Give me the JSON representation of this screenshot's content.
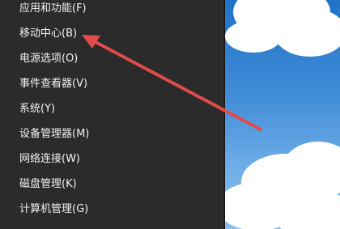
{
  "menu": {
    "items": [
      {
        "label": "应用和功能(F)"
      },
      {
        "label": "移动中心(B)"
      },
      {
        "label": "电源选项(O)"
      },
      {
        "label": "事件查看器(V)"
      },
      {
        "label": "系统(Y)"
      },
      {
        "label": "设备管理器(M)"
      },
      {
        "label": "网络连接(W)"
      },
      {
        "label": "磁盘管理(K)"
      },
      {
        "label": "计算机管理(G)"
      }
    ]
  },
  "annotation": {
    "arrow_color": "#e04b4b",
    "points_to": "移动中心(B)"
  },
  "desktop": {
    "sky_color": "#2f7fd0",
    "cloud_color": "#ffffff"
  },
  "icons": [
    "red-arrow-icon"
  ]
}
